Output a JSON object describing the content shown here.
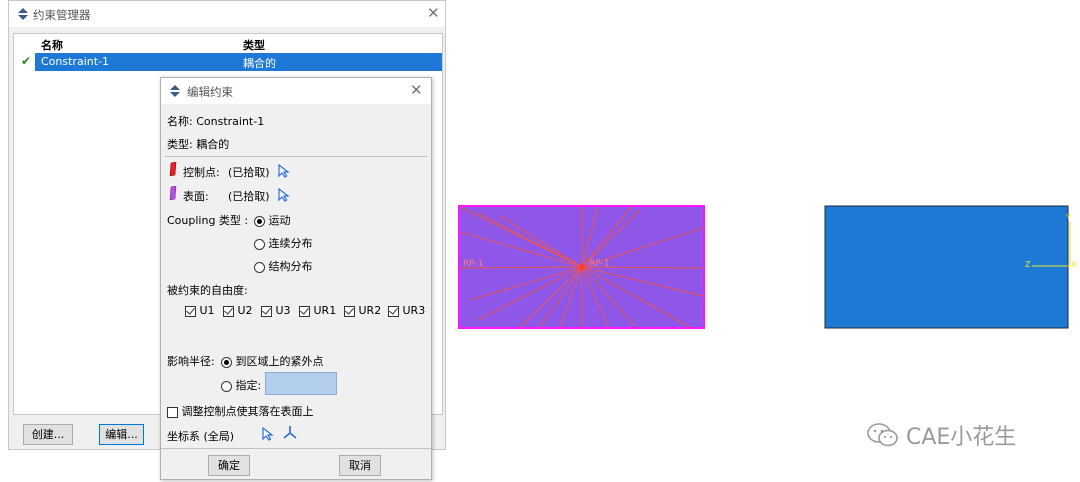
{
  "manager": {
    "title": "约束管理器",
    "columns": [
      "名称",
      "类型"
    ],
    "rows": [
      {
        "name": "Constraint-1",
        "type": "耦合的"
      }
    ],
    "buttons": {
      "create": "创建...",
      "edit": "编辑..."
    }
  },
  "editor": {
    "title": "编辑约束",
    "name_line": "名称: Constraint-1",
    "type_line": "类型: 耦合的",
    "control_point": {
      "label": "控制点:",
      "value": "(已拾取)"
    },
    "surface": {
      "label": "表面:",
      "value": "(已拾取)"
    },
    "coupling": {
      "label": "Coupling 类型 :",
      "options": [
        "运动",
        "连续分布",
        "结构分布"
      ],
      "selected": 0
    },
    "dof": {
      "label": "被约束的自由度:",
      "items": [
        "U1",
        "U2",
        "U3",
        "UR1",
        "UR2",
        "UR3"
      ]
    },
    "influence": {
      "label": "影响半径:",
      "option1": "到区域上的紧外点",
      "option2": "指定:"
    },
    "adjust": "调整控制点使其落在表面上",
    "csys": "坐标系 (全局)",
    "buttons": {
      "ok": "确定",
      "cancel": "取消"
    }
  },
  "viewport": {
    "rp_left": "RP-1",
    "rp_center": "RP-1",
    "triad": {
      "y": "Y",
      "z": "Z",
      "x": "X"
    },
    "colors": {
      "purple": "#8f57e8",
      "magenta": "#ff14ff",
      "blue": "#1d7ad4",
      "red": "#ff3b2f"
    }
  },
  "watermark": "CAE小花生"
}
